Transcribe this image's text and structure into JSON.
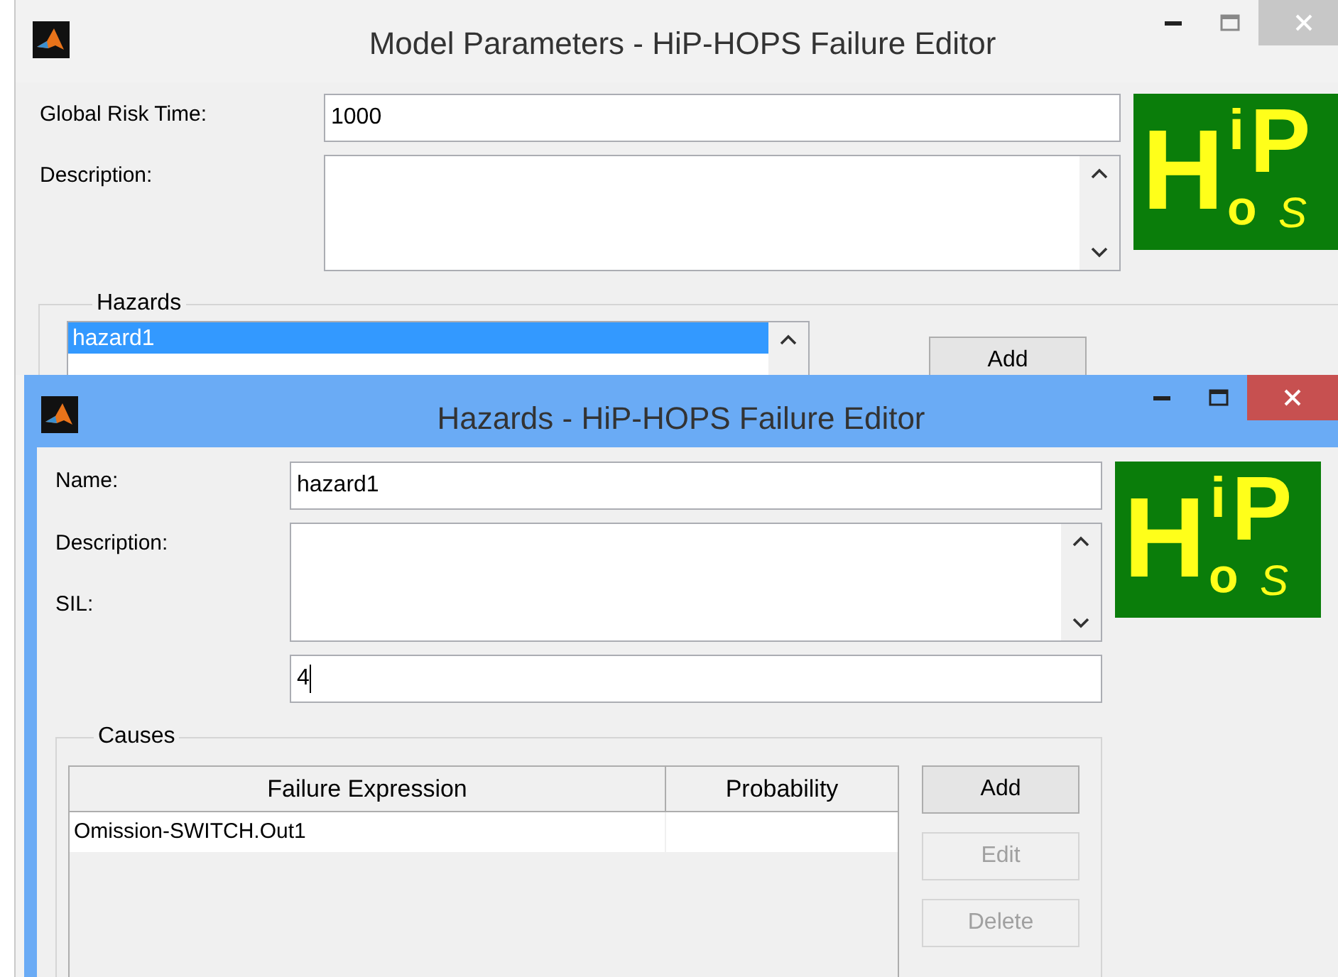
{
  "main_window": {
    "title": "Model Parameters - HiP-HOPS Failure Editor",
    "active": false,
    "fields": [
      {
        "kind": "text",
        "label": "Global Risk Time:",
        "value": "1000"
      },
      {
        "kind": "textarea",
        "label": "Description:"
      }
    ],
    "logo": [
      "H",
      "i",
      "P",
      "o",
      "S"
    ],
    "hazards": {
      "legend": "Hazards",
      "items": [
        {
          "label": "hazard1",
          "selected": true
        }
      ],
      "buttons": [
        {
          "label": "Add",
          "disabled": false
        }
      ]
    }
  },
  "hazard_window": {
    "title": "Hazards - HiP-HOPS Failure Editor",
    "active": true,
    "labels": [
      "Name:",
      "Description:",
      "SIL:"
    ],
    "fields": [
      {
        "kind": "text",
        "value": "hazard1"
      },
      {
        "kind": "textarea"
      },
      {
        "kind": "text",
        "value": "4",
        "focused": true
      }
    ],
    "logo": [
      "H",
      "i",
      "P",
      "o",
      "S"
    ],
    "causes": {
      "legend": "Causes",
      "columns": [
        "Failure Expression",
        "Probability"
      ],
      "rows": [
        {
          "failure_expression": "Omission-SWITCH.Out1"
        }
      ],
      "buttons": [
        {
          "label": "Add",
          "disabled": false
        },
        {
          "label": "Edit",
          "disabled": true
        },
        {
          "label": "Delete",
          "disabled": true
        }
      ]
    }
  }
}
